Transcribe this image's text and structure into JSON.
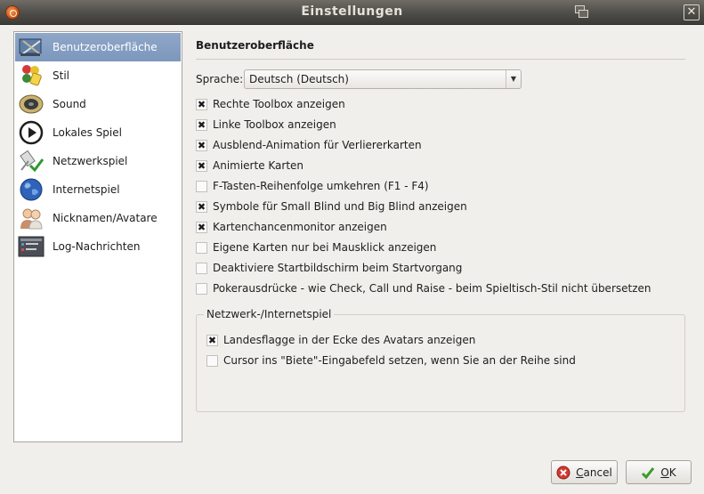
{
  "window": {
    "title": "Einstellungen"
  },
  "sidebar": {
    "items": [
      {
        "label": "Benutzeroberfläche",
        "icon": "interface-tools-icon",
        "active": true
      },
      {
        "label": "Stil",
        "icon": "style-paint-icon"
      },
      {
        "label": "Sound",
        "icon": "speaker-icon"
      },
      {
        "label": "Lokales Spiel",
        "icon": "play-icon"
      },
      {
        "label": "Netzwerkspiel",
        "icon": "network-icon"
      },
      {
        "label": "Internetspiel",
        "icon": "globe-icon"
      },
      {
        "label": "Nicknamen/Avatare",
        "icon": "users-icon"
      },
      {
        "label": "Log-Nachrichten",
        "icon": "log-window-icon"
      }
    ]
  },
  "panel": {
    "title": "Benutzeroberfläche",
    "language_label": "Sprache:",
    "language_value": "Deutsch (Deutsch)",
    "options": [
      {
        "label": "Rechte Toolbox anzeigen",
        "checked": true
      },
      {
        "label": "Linke Toolbox anzeigen",
        "checked": true
      },
      {
        "label": "Ausblend-Animation für Verliererkarten",
        "checked": true
      },
      {
        "label": "Animierte Karten",
        "checked": true
      },
      {
        "label": "F-Tasten-Reihenfolge umkehren (F1 - F4)",
        "checked": false
      },
      {
        "label": "Symbole für Small Blind und Big Blind anzeigen",
        "checked": true
      },
      {
        "label": "Kartenchancenmonitor anzeigen",
        "checked": true
      },
      {
        "label": "Eigene Karten nur bei Mausklick anzeigen",
        "checked": false
      },
      {
        "label": "Deaktiviere Startbildschirm beim Startvorgang",
        "checked": false
      },
      {
        "label": "Pokerausdrücke - wie Check, Call und Raise - beim Spieltisch-Stil nicht übersetzen",
        "checked": false
      }
    ],
    "network_group": {
      "title": "Netzwerk-/Internetspiel",
      "options": [
        {
          "label": "Landesflagge in der Ecke des Avatars anzeigen",
          "checked": true
        },
        {
          "label": "Cursor ins \"Biete\"-Eingabefeld setzen, wenn Sie an der Reihe sind",
          "checked": false
        }
      ]
    }
  },
  "buttons": {
    "cancel_first": "C",
    "cancel_rest": "ancel",
    "ok_first": "O",
    "ok_rest": "K"
  }
}
